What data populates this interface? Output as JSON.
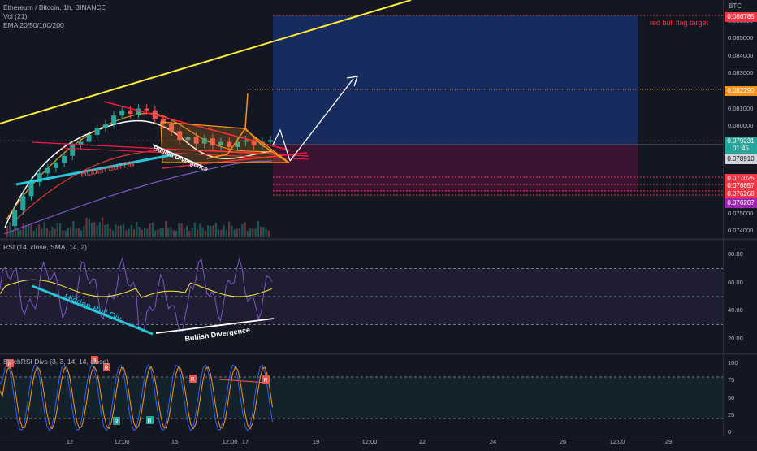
{
  "header": {
    "symbol_line": "Ethereum / Bitcoin, 1h, BINANCE",
    "vol_line": "Vol (21)",
    "ema_line": "EMA 20/50/100/200"
  },
  "price_pane": {
    "currency": "BTC",
    "ticks": [
      "0.086000",
      "0.085000",
      "0.084000",
      "0.083000",
      "0.081000",
      "0.080000",
      "0.078000",
      "0.075000",
      "0.074000"
    ],
    "tags": [
      {
        "text": "0.086785",
        "color": "#f23645"
      },
      {
        "text": "0.082290",
        "color": "#f7931a"
      },
      {
        "text": "0.079231",
        "color": "#26a69a"
      },
      {
        "text": "01:45",
        "color": "#26a69a"
      },
      {
        "text": "0.078910",
        "color": "#d1d4dc"
      },
      {
        "text": "0.077025",
        "color": "#f23645"
      },
      {
        "text": "0.076657",
        "color": "#f23645"
      },
      {
        "text": "0.076268",
        "color": "#f23645"
      },
      {
        "text": "0.076207",
        "color": "#9c27b0"
      }
    ],
    "target_label": "red bull flag target",
    "hidden_div_label": "Hidden Bull Div",
    "bull_div_label": "Bullish Divergence"
  },
  "rsi_pane": {
    "title": "RSI (14, close, SMA, 14, 2)",
    "ticks": [
      "80.00",
      "60.00",
      "40.00",
      "20.00"
    ],
    "hidden_div_label": "Hidden Bull Div",
    "bull_div_label": "Bullish Divergence"
  },
  "stoch_pane": {
    "title": "StochRSI Divs (3, 3, 14, 14, close)",
    "ticks": [
      "100",
      "75",
      "50",
      "25",
      "0"
    ],
    "marker_r": "R",
    "marker_g": "R"
  },
  "time_axis": {
    "labels": [
      "12",
      "12:00",
      "15",
      "12:00",
      "17",
      "19",
      "12:00",
      "22",
      "24",
      "26",
      "12:00",
      "29"
    ]
  },
  "colors": {
    "background": "#131722",
    "up": "#26a69a",
    "down": "#ef5350",
    "ema20": "#ffffff",
    "ema50": "#f7931a",
    "ema100": "#e53935",
    "ema200": "#7e57c2",
    "trendline": "#ffeb3b",
    "target_box": "#2962ff",
    "stop_box": "#880e4f",
    "rsi": "#7e57c2",
    "rsi_ma": "#ffeb3b",
    "hidden_div": "#26c6da",
    "flag": "#f7931a"
  },
  "chart_data": {
    "type": "line",
    "title": "Ethereum / Bitcoin, 1h, BINANCE",
    "xlabel": "",
    "ylabel": "BTC",
    "ylim": [
      0.0736,
      0.0872
    ],
    "x_ticks": [
      "12",
      "12:00",
      "15",
      "12:00",
      "17",
      "19",
      "12:00",
      "22",
      "24",
      "26",
      "12:00",
      "29"
    ],
    "series": [
      {
        "name": "",
        "values": [
          0.0743,
          0.0752,
          0.076,
          0.0768,
          0.0773,
          0.0776,
          0.0779,
          0.0783,
          0.0789,
          0.0791,
          0.0795,
          0.0799,
          0.0801,
          0.0806,
          0.0809,
          0.0807,
          0.081,
          0.0809,
          0.0804,
          0.0801,
          0.0797,
          0.0792,
          0.0794,
          0.079,
          0.0793,
          0.0789,
          0.0791,
          0.0788,
          0.0791,
          0.0792,
          0.0789,
          0.0791,
          0.0792
        ]
      }
    ],
    "annotations": [
      "red bull flag target",
      "Hidden Bull Div",
      "Bullish Divergence"
    ]
  }
}
